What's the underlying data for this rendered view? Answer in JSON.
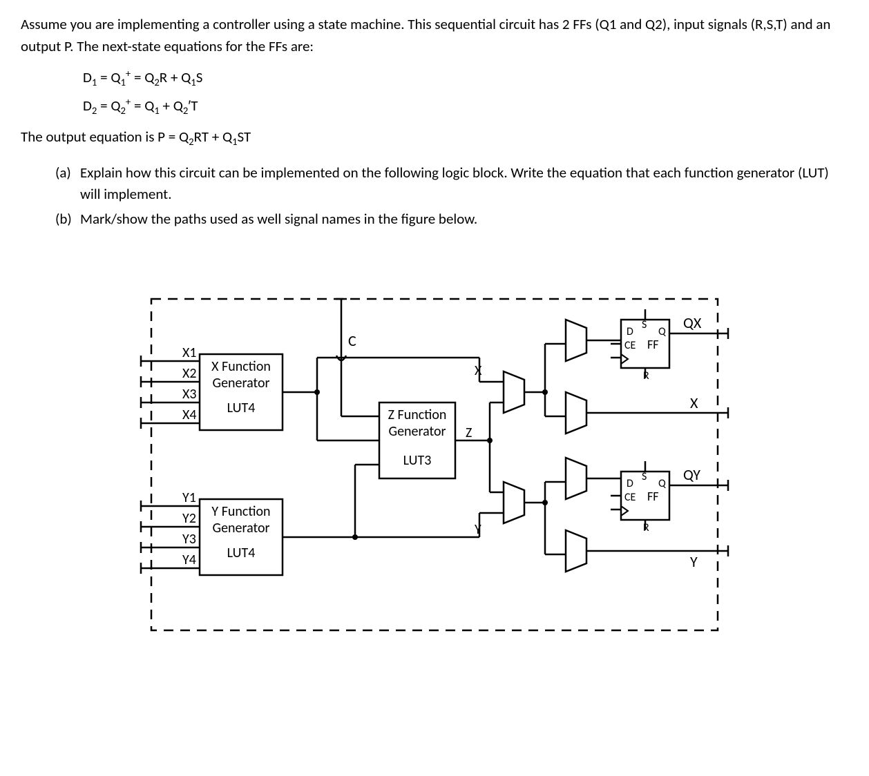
{
  "intro": "Assume you are implementing a controller using a state machine. This sequential circuit has 2 FFs (Q1 and Q2), input signals (R,S,T) and an output P. The next-state equations for the FFs are:",
  "eq1_html": "D<sub>1</sub> = Q<sub>1</sub><sup>+</sup> = Q<sub>2</sub>R + Q<sub>1</sub>S",
  "eq2_html": "D<sub>2</sub> = Q<sub>2</sub><sup>+</sup> = Q<sub>1</sub> + Q<sub>2</sub>′T",
  "outeq_prefix": "The output equation is ",
  "outeq_html": "P = Q<sub>2</sub>RT + Q<sub>1</sub>ST",
  "part_a_label": "(a)",
  "part_a": "Explain how this circuit can be implemented on the following logic block. Write the equation that each function generator (LUT) will implement.",
  "part_b_label": "(b)",
  "part_b": "Mark/show the paths used as well signal names in the figure below.",
  "diagram": {
    "x_inputs": [
      "X1",
      "X2",
      "X3",
      "X4"
    ],
    "y_inputs": [
      "Y1",
      "Y2",
      "Y3",
      "Y4"
    ],
    "x_lut_title": "X Function",
    "x_lut_sub": "Generator",
    "x_lut_name": "LUT4",
    "y_lut_title": "Y Function",
    "y_lut_sub": "Generator",
    "y_lut_name": "LUT4",
    "z_lut_title": "Z Function",
    "z_lut_sub": "Generator",
    "z_lut_name": "LUT3",
    "c_label": "C",
    "x_sig": "X",
    "y_sig": "Y",
    "z_sig": "Z",
    "ff": {
      "D": "D",
      "S": "S",
      "Q": "Q",
      "CE": "CE",
      "FF": "FF",
      "R": "R"
    },
    "outs": {
      "QX": "QX",
      "X": "X",
      "QY": "QY",
      "Y": "Y"
    }
  }
}
